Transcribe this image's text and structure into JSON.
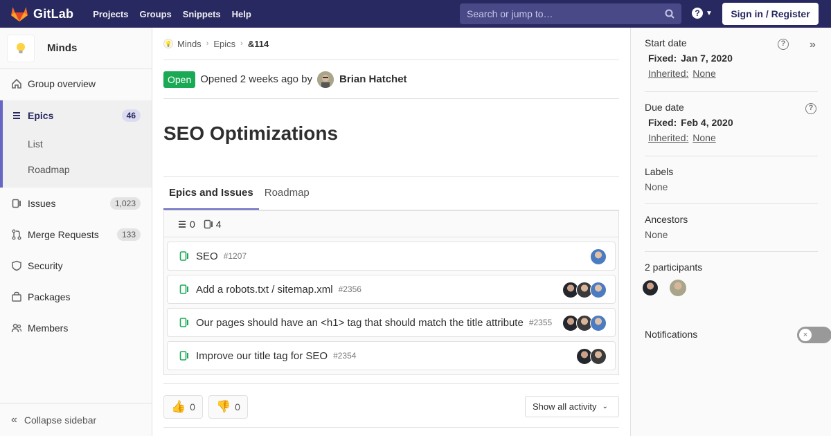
{
  "navbar": {
    "brand": "GitLab",
    "links": [
      "Projects",
      "Groups",
      "Snippets",
      "Help"
    ],
    "search_placeholder": "Search or jump to…",
    "sign_in": "Sign in / Register"
  },
  "sidebar": {
    "group_name": "Minds",
    "overview": "Group overview",
    "epics": {
      "label": "Epics",
      "count": "46",
      "sub": [
        "List",
        "Roadmap"
      ]
    },
    "items": [
      {
        "label": "Issues",
        "count": "1,023"
      },
      {
        "label": "Merge Requests",
        "count": "133"
      },
      {
        "label": "Security"
      },
      {
        "label": "Packages"
      },
      {
        "label": "Members"
      }
    ],
    "collapse": "Collapse sidebar"
  },
  "breadcrumb": {
    "group": "Minds",
    "section": "Epics",
    "current": "&114"
  },
  "epic": {
    "status": "Open",
    "opened": "Opened 2 weeks ago by",
    "author": "Brian Hatchet",
    "title": "SEO Optimizations"
  },
  "tabs": [
    "Epics and Issues",
    "Roadmap"
  ],
  "tree": {
    "epic_count": "0",
    "issue_count": "4",
    "issues": [
      {
        "title": "SEO",
        "ref": "#1207"
      },
      {
        "title": "Add a robots.txt / sitemap.xml",
        "ref": "#2356"
      },
      {
        "title": "Our pages should have an <h1> tag that should match the title attribute",
        "ref": "#2355"
      },
      {
        "title": "Improve our title tag for SEO",
        "ref": "#2354"
      }
    ]
  },
  "awards": {
    "thumbs_up": "0",
    "thumbs_down": "0"
  },
  "activity_filter": "Show all activity",
  "right_sidebar": {
    "start_date": {
      "title": "Start date",
      "fixed": "Fixed:",
      "fixed_value": "Jan 7, 2020",
      "inherited": "Inherited:",
      "inherited_value": "None"
    },
    "due_date": {
      "title": "Due date",
      "fixed": "Fixed:",
      "fixed_value": "Feb 4, 2020",
      "inherited": "Inherited:",
      "inherited_value": "None"
    },
    "labels": {
      "title": "Labels",
      "value": "None"
    },
    "ancestors": {
      "title": "Ancestors",
      "value": "None"
    },
    "participants": {
      "title": "2 participants"
    },
    "notifications": {
      "title": "Notifications"
    }
  },
  "colors": {
    "navbar": "#292961",
    "accent": "#6666c4",
    "open": "#1aaa55",
    "issue_icon": "#1aaa55"
  }
}
